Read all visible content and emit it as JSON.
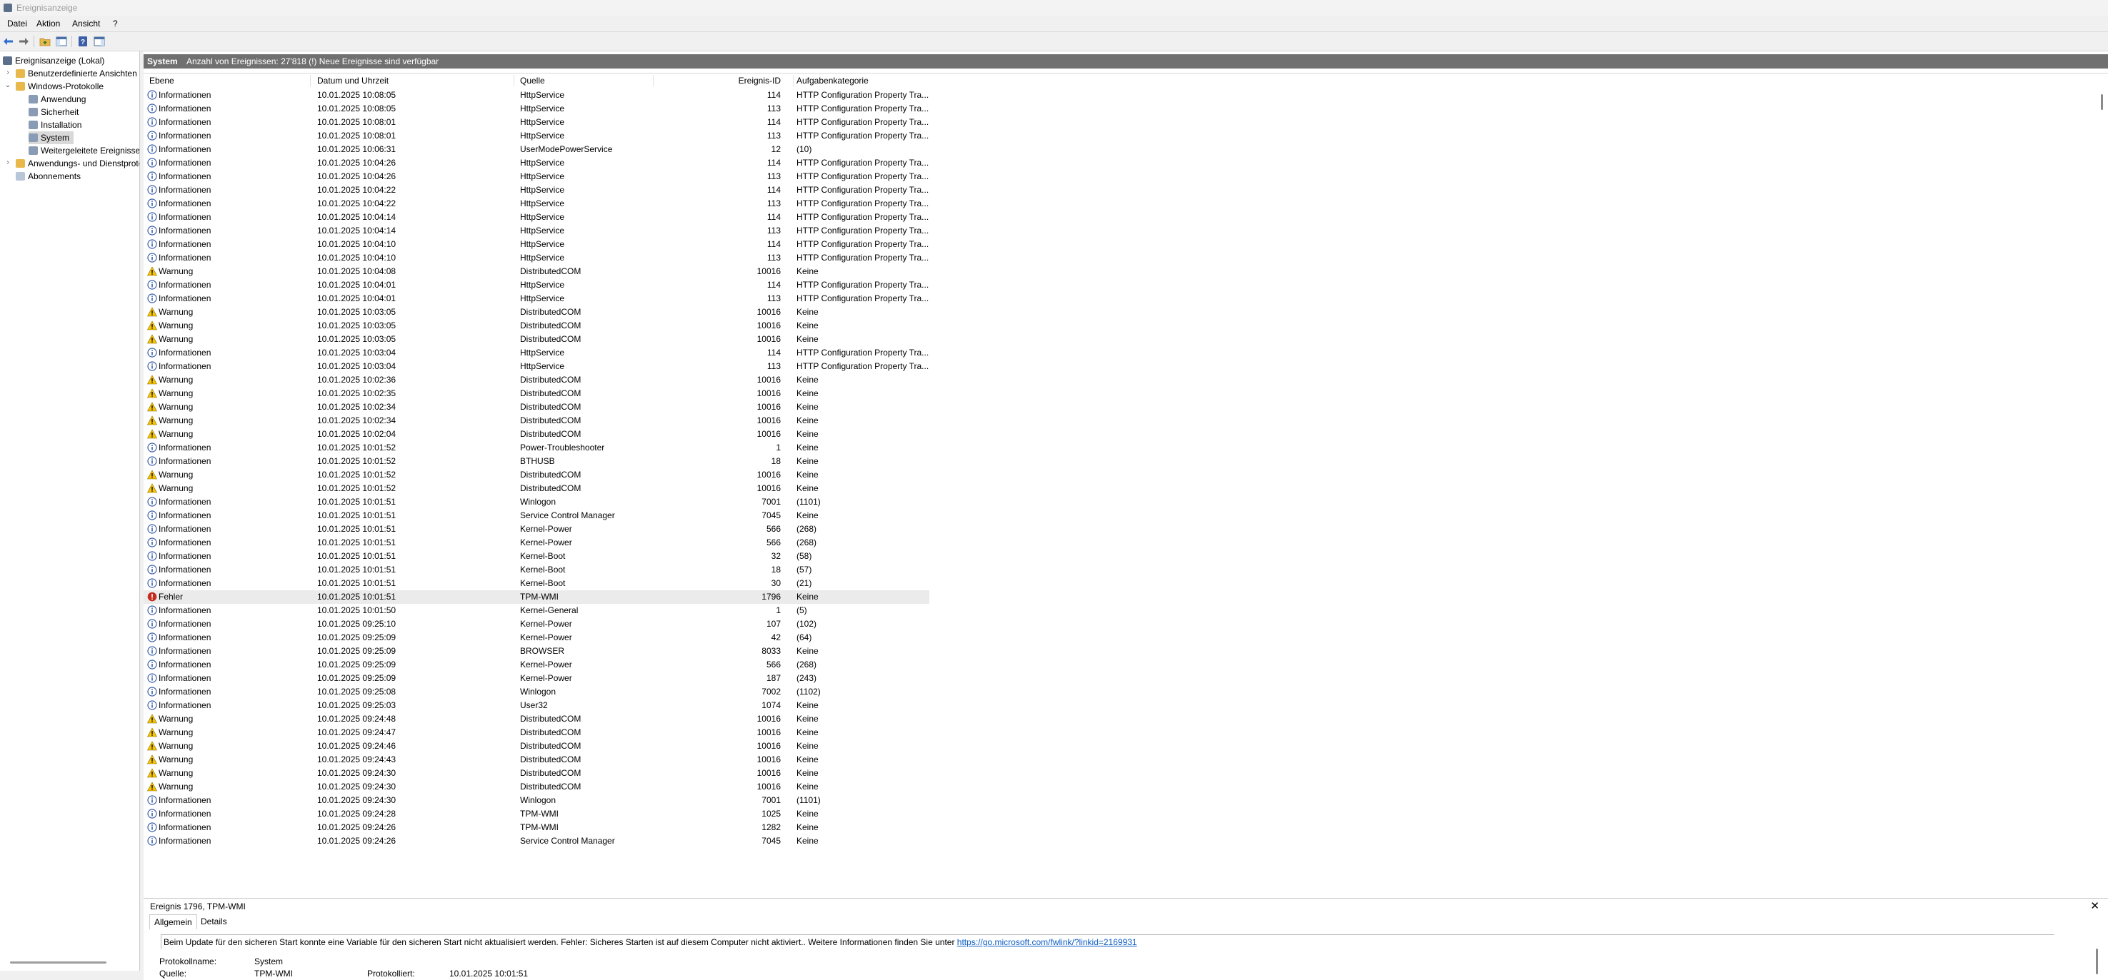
{
  "window": {
    "title": "Ereignisanzeige"
  },
  "menu": [
    "Datei",
    "Aktion",
    "Ansicht",
    "?"
  ],
  "toolbar": [
    "back-icon",
    "forward-icon",
    "folder-up-icon",
    "show-hide-tree-icon",
    "help-icon",
    "show-hide-action-icon"
  ],
  "tree": {
    "root": "Ereignisanzeige (Lokal)",
    "custom_views": "Benutzerdefinierte Ansichten",
    "windows_logs": "Windows-Protokolle",
    "logs": [
      "Anwendung",
      "Sicherheit",
      "Installation",
      "System",
      "Weitergeleitete Ereignisse"
    ],
    "app_services": "Anwendungs- und Dienstprotokolle",
    "subscriptions": "Abonnements"
  },
  "header": {
    "name": "System",
    "count": "Anzahl von Ereignissen: 27'818 (!) Neue Ereignisse sind verfügbar"
  },
  "columns": {
    "level": "Ebene",
    "date": "Datum und Uhrzeit",
    "source": "Quelle",
    "id": "Ereignis-ID",
    "task": "Aufgabenkategorie"
  },
  "events": [
    [
      "Informationen",
      "10.01.2025 10:08:05",
      "HttpService",
      "114",
      "HTTP Configuration Property Tra..."
    ],
    [
      "Informationen",
      "10.01.2025 10:08:05",
      "HttpService",
      "113",
      "HTTP Configuration Property Tra..."
    ],
    [
      "Informationen",
      "10.01.2025 10:08:01",
      "HttpService",
      "114",
      "HTTP Configuration Property Tra..."
    ],
    [
      "Informationen",
      "10.01.2025 10:08:01",
      "HttpService",
      "113",
      "HTTP Configuration Property Tra..."
    ],
    [
      "Informationen",
      "10.01.2025 10:06:31",
      "UserModePowerService",
      "12",
      "(10)"
    ],
    [
      "Informationen",
      "10.01.2025 10:04:26",
      "HttpService",
      "114",
      "HTTP Configuration Property Tra..."
    ],
    [
      "Informationen",
      "10.01.2025 10:04:26",
      "HttpService",
      "113",
      "HTTP Configuration Property Tra..."
    ],
    [
      "Informationen",
      "10.01.2025 10:04:22",
      "HttpService",
      "114",
      "HTTP Configuration Property Tra..."
    ],
    [
      "Informationen",
      "10.01.2025 10:04:22",
      "HttpService",
      "113",
      "HTTP Configuration Property Tra..."
    ],
    [
      "Informationen",
      "10.01.2025 10:04:14",
      "HttpService",
      "114",
      "HTTP Configuration Property Tra..."
    ],
    [
      "Informationen",
      "10.01.2025 10:04:14",
      "HttpService",
      "113",
      "HTTP Configuration Property Tra..."
    ],
    [
      "Informationen",
      "10.01.2025 10:04:10",
      "HttpService",
      "114",
      "HTTP Configuration Property Tra..."
    ],
    [
      "Informationen",
      "10.01.2025 10:04:10",
      "HttpService",
      "113",
      "HTTP Configuration Property Tra..."
    ],
    [
      "Warnung",
      "10.01.2025 10:04:08",
      "DistributedCOM",
      "10016",
      "Keine"
    ],
    [
      "Informationen",
      "10.01.2025 10:04:01",
      "HttpService",
      "114",
      "HTTP Configuration Property Tra..."
    ],
    [
      "Informationen",
      "10.01.2025 10:04:01",
      "HttpService",
      "113",
      "HTTP Configuration Property Tra..."
    ],
    [
      "Warnung",
      "10.01.2025 10:03:05",
      "DistributedCOM",
      "10016",
      "Keine"
    ],
    [
      "Warnung",
      "10.01.2025 10:03:05",
      "DistributedCOM",
      "10016",
      "Keine"
    ],
    [
      "Warnung",
      "10.01.2025 10:03:05",
      "DistributedCOM",
      "10016",
      "Keine"
    ],
    [
      "Informationen",
      "10.01.2025 10:03:04",
      "HttpService",
      "114",
      "HTTP Configuration Property Tra..."
    ],
    [
      "Informationen",
      "10.01.2025 10:03:04",
      "HttpService",
      "113",
      "HTTP Configuration Property Tra..."
    ],
    [
      "Warnung",
      "10.01.2025 10:02:36",
      "DistributedCOM",
      "10016",
      "Keine"
    ],
    [
      "Warnung",
      "10.01.2025 10:02:35",
      "DistributedCOM",
      "10016",
      "Keine"
    ],
    [
      "Warnung",
      "10.01.2025 10:02:34",
      "DistributedCOM",
      "10016",
      "Keine"
    ],
    [
      "Warnung",
      "10.01.2025 10:02:34",
      "DistributedCOM",
      "10016",
      "Keine"
    ],
    [
      "Warnung",
      "10.01.2025 10:02:04",
      "DistributedCOM",
      "10016",
      "Keine"
    ],
    [
      "Informationen",
      "10.01.2025 10:01:52",
      "Power-Troubleshooter",
      "1",
      "Keine"
    ],
    [
      "Informationen",
      "10.01.2025 10:01:52",
      "BTHUSB",
      "18",
      "Keine"
    ],
    [
      "Warnung",
      "10.01.2025 10:01:52",
      "DistributedCOM",
      "10016",
      "Keine"
    ],
    [
      "Warnung",
      "10.01.2025 10:01:52",
      "DistributedCOM",
      "10016",
      "Keine"
    ],
    [
      "Informationen",
      "10.01.2025 10:01:51",
      "Winlogon",
      "7001",
      "(1101)"
    ],
    [
      "Informationen",
      "10.01.2025 10:01:51",
      "Service Control Manager",
      "7045",
      "Keine"
    ],
    [
      "Informationen",
      "10.01.2025 10:01:51",
      "Kernel-Power",
      "566",
      "(268)"
    ],
    [
      "Informationen",
      "10.01.2025 10:01:51",
      "Kernel-Power",
      "566",
      "(268)"
    ],
    [
      "Informationen",
      "10.01.2025 10:01:51",
      "Kernel-Boot",
      "32",
      "(58)"
    ],
    [
      "Informationen",
      "10.01.2025 10:01:51",
      "Kernel-Boot",
      "18",
      "(57)"
    ],
    [
      "Informationen",
      "10.01.2025 10:01:51",
      "Kernel-Boot",
      "30",
      "(21)"
    ],
    [
      "Fehler",
      "10.01.2025 10:01:51",
      "TPM-WMI",
      "1796",
      "Keine"
    ],
    [
      "Informationen",
      "10.01.2025 10:01:50",
      "Kernel-General",
      "1",
      "(5)"
    ],
    [
      "Informationen",
      "10.01.2025 09:25:10",
      "Kernel-Power",
      "107",
      "(102)"
    ],
    [
      "Informationen",
      "10.01.2025 09:25:09",
      "Kernel-Power",
      "42",
      "(64)"
    ],
    [
      "Informationen",
      "10.01.2025 09:25:09",
      "BROWSER",
      "8033",
      "Keine"
    ],
    [
      "Informationen",
      "10.01.2025 09:25:09",
      "Kernel-Power",
      "566",
      "(268)"
    ],
    [
      "Informationen",
      "10.01.2025 09:25:09",
      "Kernel-Power",
      "187",
      "(243)"
    ],
    [
      "Informationen",
      "10.01.2025 09:25:08",
      "Winlogon",
      "7002",
      "(1102)"
    ],
    [
      "Informationen",
      "10.01.2025 09:25:03",
      "User32",
      "1074",
      "Keine"
    ],
    [
      "Warnung",
      "10.01.2025 09:24:48",
      "DistributedCOM",
      "10016",
      "Keine"
    ],
    [
      "Warnung",
      "10.01.2025 09:24:47",
      "DistributedCOM",
      "10016",
      "Keine"
    ],
    [
      "Warnung",
      "10.01.2025 09:24:46",
      "DistributedCOM",
      "10016",
      "Keine"
    ],
    [
      "Warnung",
      "10.01.2025 09:24:43",
      "DistributedCOM",
      "10016",
      "Keine"
    ],
    [
      "Warnung",
      "10.01.2025 09:24:30",
      "DistributedCOM",
      "10016",
      "Keine"
    ],
    [
      "Warnung",
      "10.01.2025 09:24:30",
      "DistributedCOM",
      "10016",
      "Keine"
    ],
    [
      "Informationen",
      "10.01.2025 09:24:30",
      "Winlogon",
      "7001",
      "(1101)"
    ],
    [
      "Informationen",
      "10.01.2025 09:24:28",
      "TPM-WMI",
      "1025",
      "Keine"
    ],
    [
      "Informationen",
      "10.01.2025 09:24:26",
      "TPM-WMI",
      "1282",
      "Keine"
    ],
    [
      "Informationen",
      "10.01.2025 09:24:26",
      "Service Control Manager",
      "7045",
      "Keine"
    ]
  ],
  "selected_event_index": 37,
  "details": {
    "title": "Ereignis 1796, TPM-WMI",
    "tabs": [
      "Allgemein",
      "Details"
    ],
    "message": "Beim Update für den sicheren Start konnte eine Variable für den sicheren Start nicht aktualisiert werden. Fehler: Sicheres Starten ist auf diesem Computer nicht aktiviert.. Weitere Informationen finden Sie unter",
    "link": "https://go.microsoft.com/fwlink/?linkid=2169931",
    "log_name_label": "Protokollname:",
    "log_name_value": "System",
    "source_label": "Quelle:",
    "source_value": "TPM-WMI",
    "logged_label": "Protokolliert:",
    "logged_value": "10.01.2025 10:01:51"
  },
  "colors": {
    "header": "#707070",
    "selected_row": "#ebebeb",
    "link": "#0b5cc3",
    "warning": "#f5c400",
    "error": "#c42b1c",
    "info": "#3a5ea8"
  }
}
